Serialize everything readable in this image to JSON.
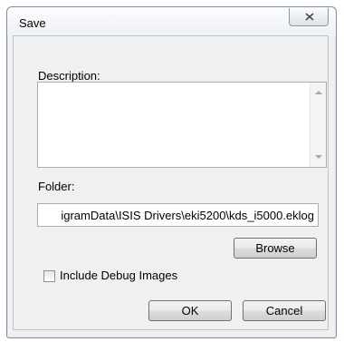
{
  "window": {
    "title": "Save"
  },
  "description": {
    "label": "Description:",
    "value": ""
  },
  "folder": {
    "label": "Folder:",
    "value": "igramData\\ISIS Drivers\\eki5200\\kds_i5000.eklog"
  },
  "buttons": {
    "browse": "Browse",
    "ok": "OK",
    "cancel": "Cancel"
  },
  "options": {
    "include_debug_images_label": "Include Debug Images",
    "include_debug_images_checked": false
  },
  "icons": {
    "close": "close-icon",
    "scroll_up": "scroll-up-arrow-icon",
    "scroll_down": "scroll-down-arrow-icon"
  }
}
